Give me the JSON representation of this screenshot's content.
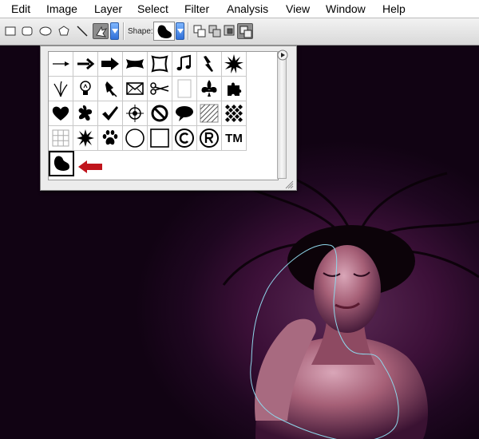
{
  "menubar": {
    "items": [
      "Edit",
      "Image",
      "Layer",
      "Select",
      "Filter",
      "Analysis",
      "View",
      "Window",
      "Help"
    ]
  },
  "options_bar": {
    "shape_label": "Shape:"
  },
  "shape_picker": {
    "tm_glyph": "TM",
    "selected_shape": "custom-blob",
    "arrow_color": "#c0141c"
  },
  "canvas": {
    "path_color": "#8fd6ea",
    "background_color": "#2a0a2c"
  }
}
